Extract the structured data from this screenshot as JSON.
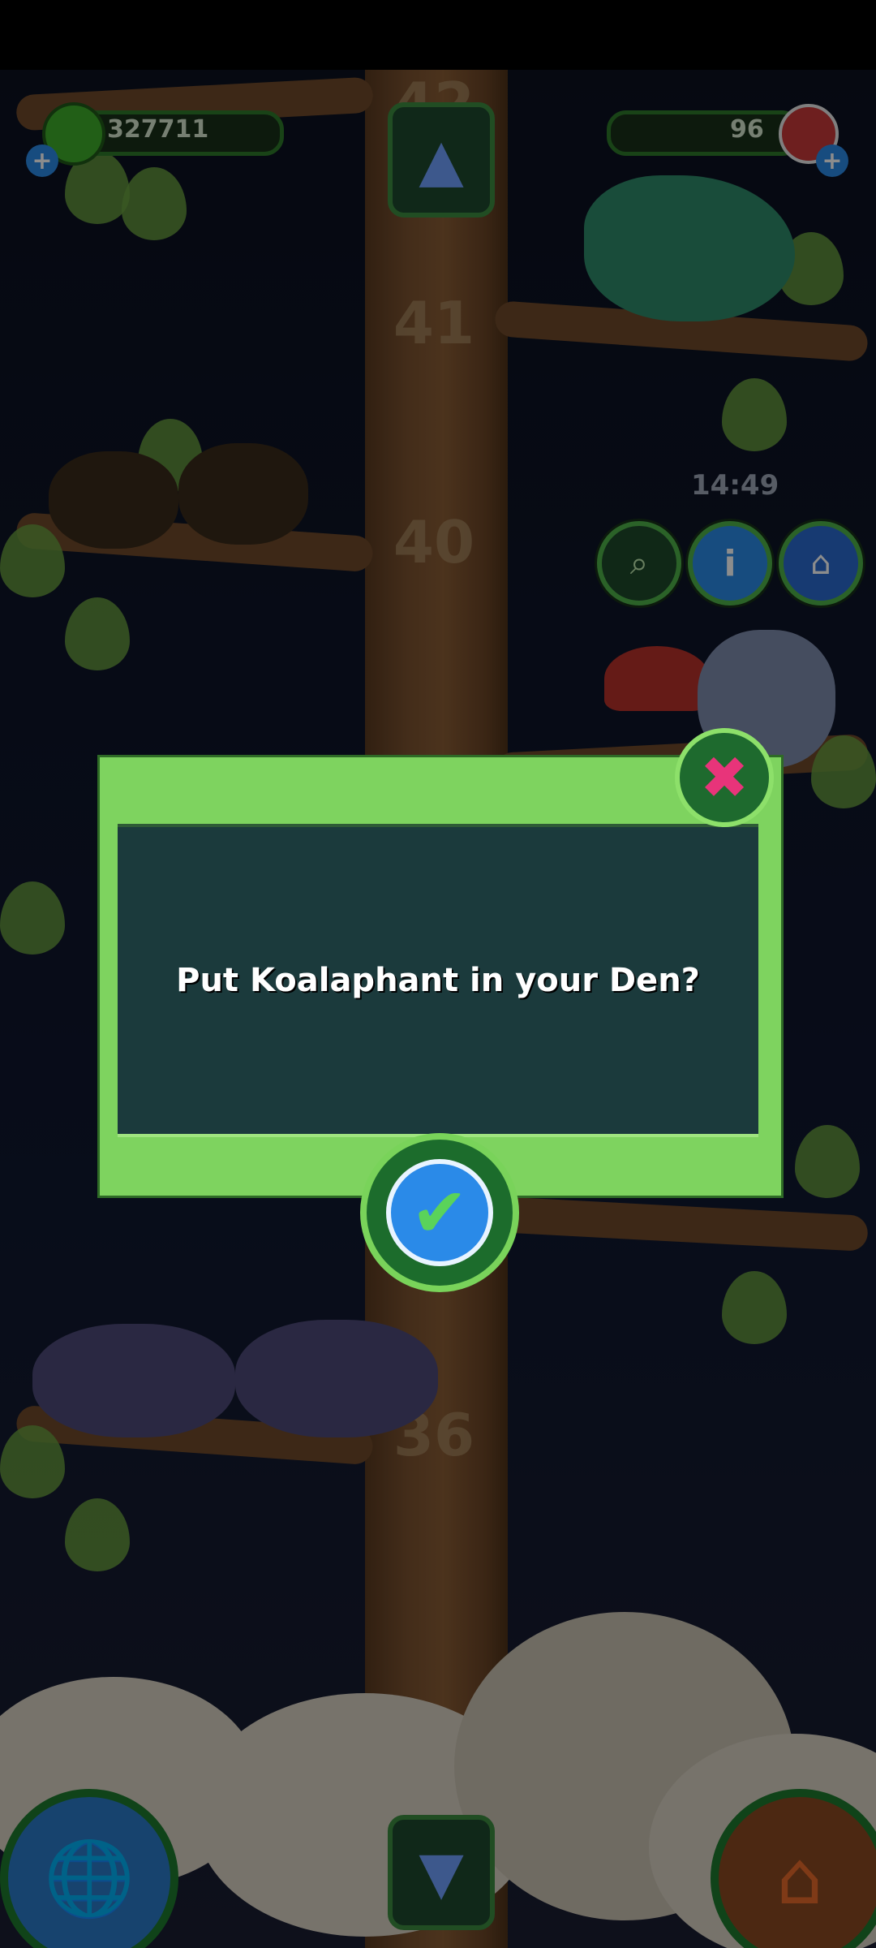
{
  "hud": {
    "coins": "327711",
    "gems": "96",
    "time": "14:49"
  },
  "floors": [
    "42",
    "41",
    "40",
    "36"
  ],
  "dialog": {
    "message": "Put Koalaphant in your Den?"
  },
  "icons": {
    "coin": "green-coin-icon",
    "gem": "red-gem-icon",
    "add": "plus-icon",
    "up": "up-arrow-icon",
    "down": "down-arrow-icon",
    "net": "butterfly-net-icon",
    "info": "info-icon",
    "den": "den-icon",
    "close": "close-x-icon",
    "confirm": "checkmark-icon",
    "map": "globe-icon",
    "home": "house-icon"
  },
  "colors": {
    "dialog_green": "#7ed35f",
    "dialog_panel": "#1b3a3c",
    "close_pink": "#e8347a",
    "check_blue": "#2a8ae8"
  }
}
